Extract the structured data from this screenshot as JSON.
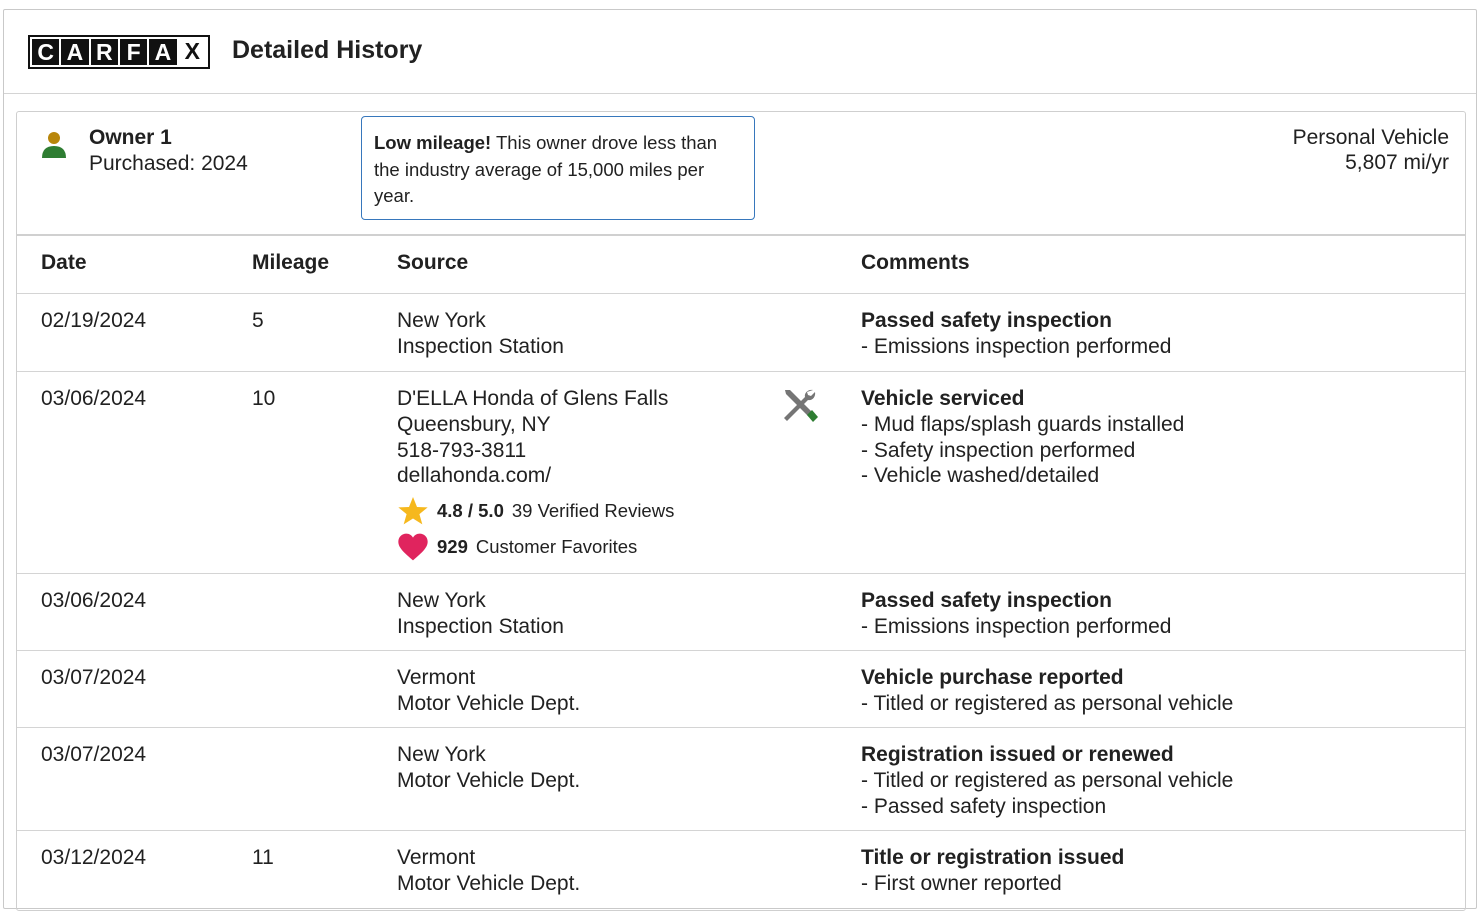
{
  "header": {
    "logo_letters": [
      "C",
      "A",
      "R",
      "F",
      "A",
      "X"
    ],
    "title": "Detailed History"
  },
  "owner": {
    "name": "Owner 1",
    "purchased": "Purchased: 2024",
    "callout_bold": "Low mileage!",
    "callout_text": " This owner drove less than the industry average of 15,000 miles per year.",
    "usage_type": "Personal Vehicle",
    "usage_rate": "5,807 mi/yr"
  },
  "table": {
    "columns": [
      "Date",
      "Mileage",
      "Source",
      "Comments"
    ],
    "rows": [
      {
        "date": "02/19/2024",
        "mileage": "5",
        "source": [
          "New York",
          "Inspection Station"
        ],
        "comment_title": "Passed safety inspection",
        "comment_items": [
          "Emissions inspection performed"
        ]
      },
      {
        "date": "03/06/2024",
        "mileage": "10",
        "source": [
          "D'ELLA Honda of Glens Falls",
          "Queensbury, NY",
          "518-793-3811",
          "dellahonda.com/"
        ],
        "rating": "4.8 / 5.0",
        "reviews": "39 Verified Reviews",
        "favorites_count": "929",
        "favorites_label": "Customer Favorites",
        "comment_title": "Vehicle serviced",
        "comment_items": [
          "Mud flaps/splash guards installed",
          "Safety inspection performed",
          "Vehicle washed/detailed"
        ]
      },
      {
        "date": "03/06/2024",
        "mileage": "",
        "source": [
          "New York",
          "Inspection Station"
        ],
        "comment_title": "Passed safety inspection",
        "comment_items": [
          "Emissions inspection performed"
        ]
      },
      {
        "date": "03/07/2024",
        "mileage": "",
        "source": [
          "Vermont",
          "Motor Vehicle Dept."
        ],
        "comment_title": "Vehicle purchase reported",
        "comment_items": [
          "Titled or registered as personal vehicle"
        ]
      },
      {
        "date": "03/07/2024",
        "mileage": "",
        "source": [
          "New York",
          "Motor Vehicle Dept."
        ],
        "comment_title": "Registration issued or renewed",
        "comment_items": [
          "Titled or registered as personal vehicle",
          "Passed safety inspection"
        ]
      },
      {
        "date": "03/12/2024",
        "mileage": "11",
        "source": [
          "Vermont",
          "Motor Vehicle Dept."
        ],
        "comment_title": "Title or registration issued",
        "comment_items": [
          "First owner reported"
        ]
      }
    ]
  },
  "icons": {
    "owner": "person-icon",
    "service": "wrench-screwdriver-icon",
    "rating": "star-icon",
    "favorites": "heart-icon"
  },
  "colors": {
    "person_head": "#b8860b",
    "person_body": "#2e7d32",
    "callout_border": "#3777bc",
    "star": "#f6b81d",
    "heart": "#e0245e",
    "service_green": "#2e7d32",
    "service_gray": "#757575"
  }
}
